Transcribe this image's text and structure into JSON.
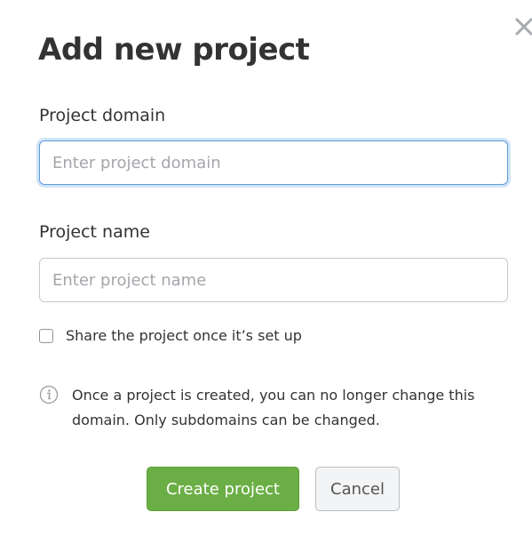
{
  "dialog": {
    "title": "Add new project",
    "close_icon": "close-icon"
  },
  "form": {
    "domain": {
      "label": "Project domain",
      "placeholder": "Enter project domain",
      "value": ""
    },
    "name": {
      "label": "Project name",
      "placeholder": "Enter project name",
      "value": ""
    },
    "share": {
      "label": "Share the project once it’s set up",
      "checked": false
    }
  },
  "notice": {
    "icon": "info-icon",
    "line1": "Once a project is created, you can no longer change this",
    "line2": "domain. Only subdomains can be changed."
  },
  "actions": {
    "create_label": "Create project",
    "cancel_label": "Cancel"
  },
  "colors": {
    "primary": "#6bae45",
    "focus": "#5b9bd9",
    "text": "#333333"
  }
}
